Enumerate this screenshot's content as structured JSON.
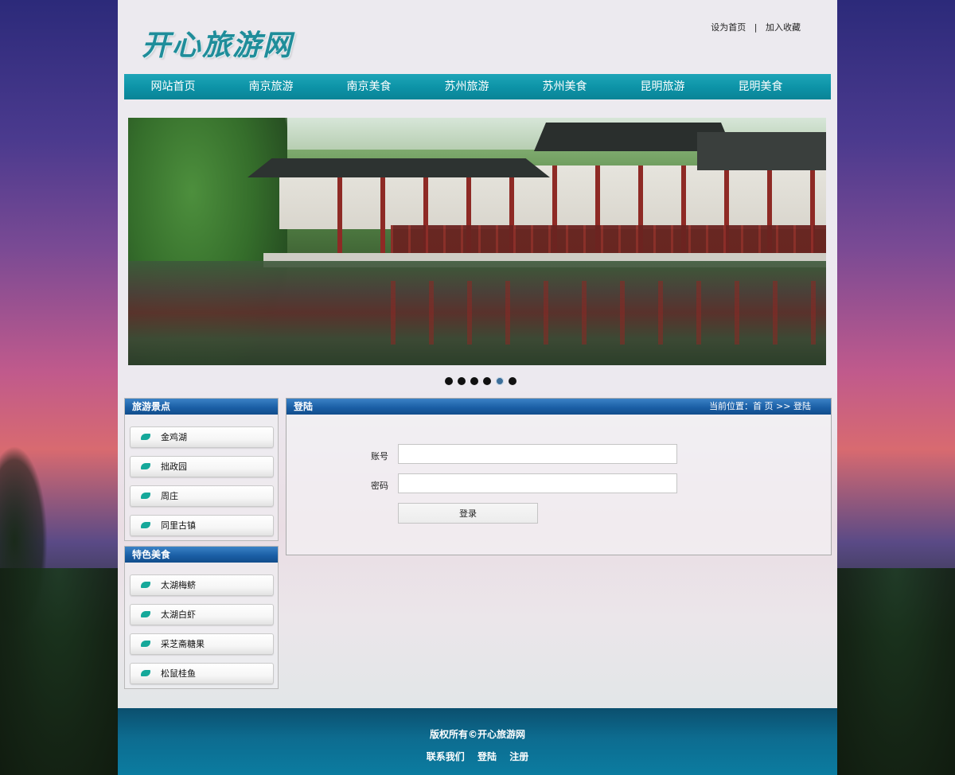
{
  "header": {
    "logo_text": "开心旅游网",
    "links": [
      "设为首页",
      "加入收藏"
    ],
    "separator": "|"
  },
  "nav": {
    "items": [
      "网站首页",
      "南京旅游",
      "南京美食",
      "苏州旅游",
      "苏州美食",
      "昆明旅游",
      "昆明美食"
    ]
  },
  "slider": {
    "total": 6,
    "active_index": 4
  },
  "sidebar": {
    "attractions": {
      "title": "旅游景点",
      "items": [
        "金鸡湖",
        "拙政园",
        "周庄",
        "同里古镇"
      ]
    },
    "food": {
      "title": "特色美食",
      "items": [
        "太湖梅鲚",
        "太湖白虾",
        "采芝斋糖果",
        "松鼠桂鱼"
      ]
    }
  },
  "login": {
    "title": "登陆",
    "breadcrumb": "当前位置：首 页 >> 登陆",
    "account_label": "账号",
    "password_label": "密码",
    "account_value": "",
    "password_value": "",
    "submit_label": "登录"
  },
  "footer": {
    "copyright": "版权所有©开心旅游网",
    "links": [
      "联系我们",
      "登陆",
      "注册"
    ]
  },
  "colors": {
    "nav_bg": "#0d94a8",
    "box_head": "#1b5fa6",
    "footer_bg": "#0d6c90",
    "logo": "#1f8d9a",
    "leaf": "#15a89a"
  }
}
